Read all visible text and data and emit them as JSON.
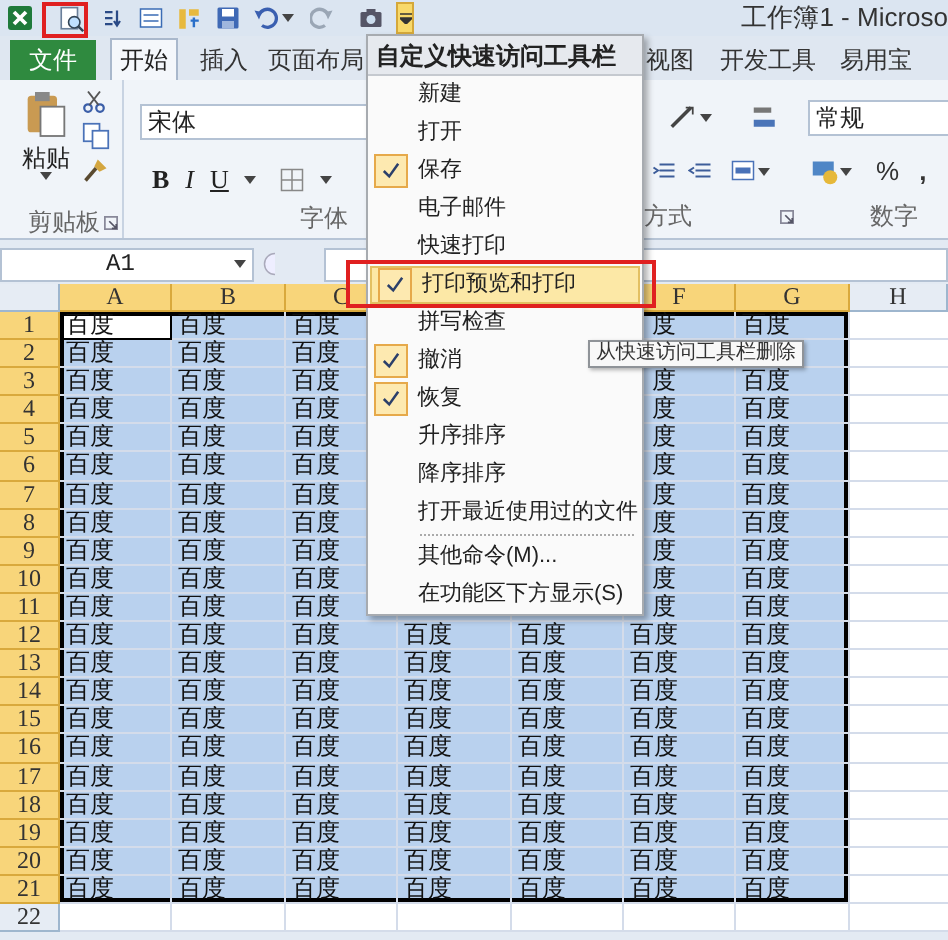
{
  "window": {
    "title": "工作簿1 - Microso"
  },
  "tabs": [
    {
      "label": "文件",
      "kind": "file",
      "selected": false
    },
    {
      "label": "开始",
      "kind": "tab",
      "selected": true
    },
    {
      "label": "插入",
      "kind": "tab",
      "selected": false
    },
    {
      "label": "页面布局",
      "kind": "tab",
      "selected": false
    },
    {
      "label": "视图",
      "kind": "tab",
      "selected": false
    },
    {
      "label": "开发工具",
      "kind": "tab",
      "selected": false
    },
    {
      "label": "易用宝",
      "kind": "tab",
      "selected": false
    }
  ],
  "ribbon": {
    "clipboard": {
      "paste": "粘贴",
      "label": "剪贴板"
    },
    "font": {
      "name": "宋体",
      "bold": "B",
      "italic": "I",
      "underline": "U",
      "label": "字体"
    },
    "alignment": {
      "label": "方式"
    },
    "number": {
      "format": "常规",
      "percent": "%",
      "comma": ",",
      "label": "数字"
    }
  },
  "name_box": {
    "value": "A1"
  },
  "sheet": {
    "columns_left": [
      {
        "label": "A",
        "selected": true
      },
      {
        "label": "B",
        "selected": true
      },
      {
        "label": "C",
        "selected": true
      }
    ],
    "columns_right": [
      {
        "label": "F",
        "selected": true
      },
      {
        "label": "G",
        "selected": true
      },
      {
        "label": "H",
        "selected": false
      }
    ],
    "rows": [
      {
        "header": "1",
        "selected": true,
        "active_cell": true,
        "left": [
          "百度",
          "百度",
          "百度"
        ],
        "right": [
          "度",
          "百度"
        ]
      },
      {
        "header": "2",
        "selected": true,
        "active_cell": false,
        "left": [
          "百度",
          "百度",
          "百度"
        ]
      },
      {
        "header": "3",
        "selected": true,
        "active_cell": false,
        "left": [
          "百度",
          "百度",
          "百度"
        ],
        "right": [
          "度",
          "百度"
        ]
      },
      {
        "header": "4",
        "selected": true,
        "active_cell": false,
        "left": [
          "百度",
          "百度",
          "百度"
        ],
        "right": [
          "度",
          "百度"
        ]
      },
      {
        "header": "5",
        "selected": true,
        "active_cell": false,
        "left": [
          "百度",
          "百度",
          "百度"
        ],
        "right": [
          "度",
          "百度"
        ]
      },
      {
        "header": "6",
        "selected": true,
        "active_cell": false,
        "left": [
          "百度",
          "百度",
          "百度"
        ],
        "right": [
          "度",
          "百度"
        ]
      },
      {
        "header": "7",
        "selected": true,
        "active_cell": false,
        "left": [
          "百度",
          "百度",
          "百度"
        ],
        "right": [
          "度",
          "百度"
        ]
      },
      {
        "header": "8",
        "selected": true,
        "active_cell": false,
        "left": [
          "百度",
          "百度",
          "百度"
        ],
        "right": [
          "度",
          "百度"
        ]
      },
      {
        "header": "9",
        "selected": true,
        "active_cell": false,
        "left": [
          "百度",
          "百度",
          "百度"
        ],
        "right": [
          "度",
          "百度"
        ]
      },
      {
        "header": "10",
        "selected": true,
        "active_cell": false,
        "left": [
          "百度",
          "百度",
          "百度"
        ],
        "right": [
          "度",
          "百度"
        ]
      },
      {
        "header": "11",
        "selected": true,
        "active_cell": false,
        "left": [
          "百度",
          "百度",
          "百度"
        ],
        "right": [
          "度",
          "百度"
        ]
      },
      {
        "header": "12",
        "selected": true,
        "active_cell": false,
        "cells": [
          "百度",
          "百度",
          "百度",
          "百度",
          "百度",
          "百度",
          "百度"
        ]
      },
      {
        "header": "13",
        "selected": true,
        "active_cell": false,
        "cells": [
          "百度",
          "百度",
          "百度",
          "百度",
          "百度",
          "百度",
          "百度"
        ]
      },
      {
        "header": "14",
        "selected": true,
        "active_cell": false,
        "cells": [
          "百度",
          "百度",
          "百度",
          "百度",
          "百度",
          "百度",
          "百度"
        ]
      },
      {
        "header": "15",
        "selected": true,
        "active_cell": false,
        "cells": [
          "百度",
          "百度",
          "百度",
          "百度",
          "百度",
          "百度",
          "百度"
        ]
      },
      {
        "header": "16",
        "selected": true,
        "active_cell": false,
        "cells": [
          "百度",
          "百度",
          "百度",
          "百度",
          "百度",
          "百度",
          "百度"
        ]
      },
      {
        "header": "17",
        "selected": true,
        "active_cell": false,
        "cells": [
          "百度",
          "百度",
          "百度",
          "百度",
          "百度",
          "百度",
          "百度"
        ]
      },
      {
        "header": "18",
        "selected": true,
        "active_cell": false,
        "cells": [
          "百度",
          "百度",
          "百度",
          "百度",
          "百度",
          "百度",
          "百度"
        ]
      },
      {
        "header": "19",
        "selected": true,
        "active_cell": false,
        "cells": [
          "百度",
          "百度",
          "百度",
          "百度",
          "百度",
          "百度",
          "百度"
        ]
      },
      {
        "header": "20",
        "selected": true,
        "active_cell": false,
        "cells": [
          "百度",
          "百度",
          "百度",
          "百度",
          "百度",
          "百度",
          "百度"
        ]
      },
      {
        "header": "21",
        "selected": true,
        "active_cell": false,
        "cells": [
          "百度",
          "百度",
          "百度",
          "百度",
          "百度",
          "百度",
          "百度"
        ]
      },
      {
        "header": "22",
        "selected": false,
        "active_cell": false
      }
    ]
  },
  "menu": {
    "title": "自定义快速访问工具栏",
    "items": [
      {
        "label": "新建",
        "checked": false,
        "selected": false
      },
      {
        "label": "打开",
        "checked": false,
        "selected": false
      },
      {
        "label": "保存",
        "checked": true,
        "selected": false
      },
      {
        "label": "电子邮件",
        "checked": false,
        "selected": false
      },
      {
        "label": "快速打印",
        "checked": false,
        "selected": false
      },
      {
        "label": "打印预览和打印",
        "checked": true,
        "selected": true
      },
      {
        "label": "拼写检查",
        "checked": false,
        "selected": false
      },
      {
        "label": "撤消",
        "checked": true,
        "selected": false
      },
      {
        "label": "恢复",
        "checked": true,
        "selected": false
      },
      {
        "label": "升序排序",
        "checked": false,
        "selected": false
      },
      {
        "label": "降序排序",
        "checked": false,
        "selected": false
      },
      {
        "label": "打开最近使用过的文件",
        "checked": false,
        "selected": false
      }
    ],
    "more_items": [
      {
        "label": "其他命令(M)..."
      },
      {
        "label": "在功能区下方显示(S)"
      }
    ]
  },
  "tooltip": {
    "text": "从快速访问工具栏删除"
  }
}
